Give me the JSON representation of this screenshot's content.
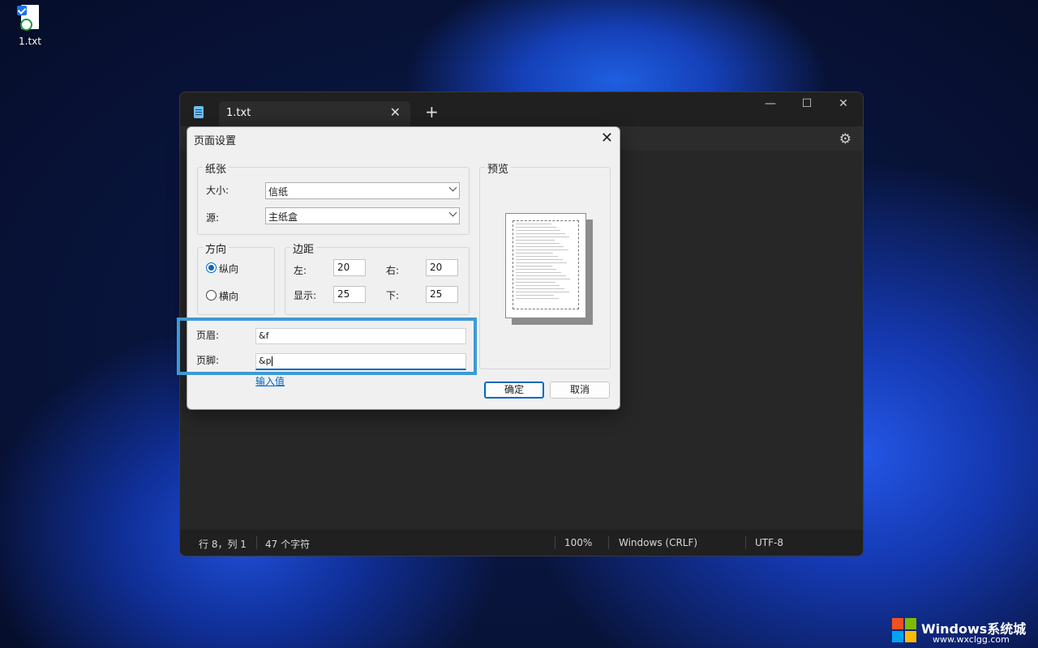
{
  "desktop": {
    "icon_label": "1.txt"
  },
  "notepad": {
    "tab_title": "1.txt",
    "tab_close": "✕",
    "new_tab": "+",
    "minimize": "—",
    "maximize": "☐",
    "close": "✕",
    "settings_icon": "⚙",
    "status": {
      "position": "行 8，列 1",
      "chars": "47 个字符",
      "zoom": "100%",
      "line_ending": "Windows (CRLF)",
      "encoding": "UTF-8"
    }
  },
  "dialog": {
    "title": "页面设置",
    "close": "✕",
    "paper": {
      "group": "纸张",
      "size_label": "大小:",
      "size_value": "信纸",
      "source_label": "源:",
      "source_value": "主纸盒"
    },
    "orientation": {
      "group": "方向",
      "portrait": "纵向",
      "landscape": "横向",
      "selected": "portrait"
    },
    "margins": {
      "group": "边距",
      "left_label": "左:",
      "left_value": "20",
      "right_label": "右:",
      "right_value": "20",
      "top_label": "显示:",
      "top_value": "25",
      "bottom_label": "下:",
      "bottom_value": "25"
    },
    "header_label": "页眉:",
    "header_value": "&f",
    "footer_label": "页脚:",
    "footer_value": "&p",
    "input_values_link": "输入值",
    "preview_group": "预览",
    "ok": "确定",
    "cancel": "取消"
  },
  "watermark": {
    "text": "Windows系统城",
    "url": "www.wxclgg.com"
  },
  "colors": {
    "accent": "#0067c0",
    "highlight_box": "#3d9ad6",
    "notepad_bg": "#272727"
  }
}
